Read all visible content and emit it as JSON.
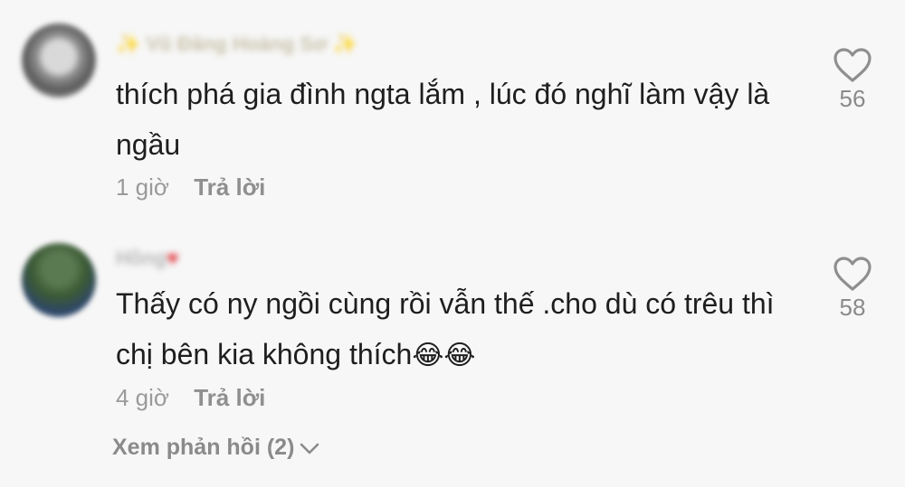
{
  "comments": [
    {
      "username": "✨ Vũ Đăng Hoàng Sơ ✨",
      "text": "thích phá gia đình ngta lắm , lúc đó nghĩ làm vậy là ngầu",
      "time": "1 giờ",
      "reply_label": "Trả lời",
      "like_count": "56"
    },
    {
      "username": "Hồng",
      "username_decoration": "♥",
      "text": "Thấy có ny ngồi cùng rồi vẫn thế .cho dù có trêu thì chị bên kia không thích",
      "emoji": "😂😂",
      "time": "4 giờ",
      "reply_label": "Trả lời",
      "like_count": "58"
    }
  ],
  "view_replies_label": "Xem phản hồi (2)",
  "icons": {
    "like": "heart-outline-icon",
    "expand": "chevron-down-icon"
  },
  "colors": {
    "background": "#f7f7f7",
    "text": "#1e1e1e",
    "muted": "#9a9a9a"
  }
}
